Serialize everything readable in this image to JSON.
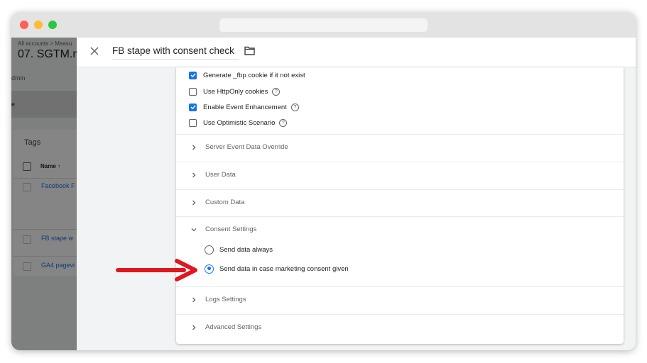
{
  "browser": {
    "url": ""
  },
  "background": {
    "breadcrumb": "All accounts > Measu",
    "container_title": "07. SGTM.m",
    "admin_tab": "dmin",
    "band_text": "e",
    "card_title": "Tags",
    "name_header": "Name ↑",
    "rows": [
      "Facebook F",
      "FB stape w",
      "GA4 pagevi"
    ]
  },
  "panel": {
    "tag_name": "FB stape with consent check",
    "options": [
      {
        "label": "Generate _fbp cookie if it not exist",
        "checked": true,
        "help": false
      },
      {
        "label": "Use HttpOnly cookies",
        "checked": false,
        "help": true
      },
      {
        "label": "Enable Event Enhancement",
        "checked": true,
        "help": true
      },
      {
        "label": "Use Optimistic Scenario",
        "checked": false,
        "help": true
      }
    ],
    "sections": {
      "server_event": "Server Event Data Override",
      "user_data": "User Data",
      "custom_data": "Custom Data",
      "consent": "Consent Settings",
      "logs": "Logs Settings",
      "advanced": "Advanced Settings"
    },
    "consent_options": [
      {
        "label": "Send data always",
        "selected": false
      },
      {
        "label": "Send data in case marketing consent given",
        "selected": true
      }
    ]
  },
  "colors": {
    "accent": "#1a73e8",
    "arrow": "#e0171f"
  }
}
